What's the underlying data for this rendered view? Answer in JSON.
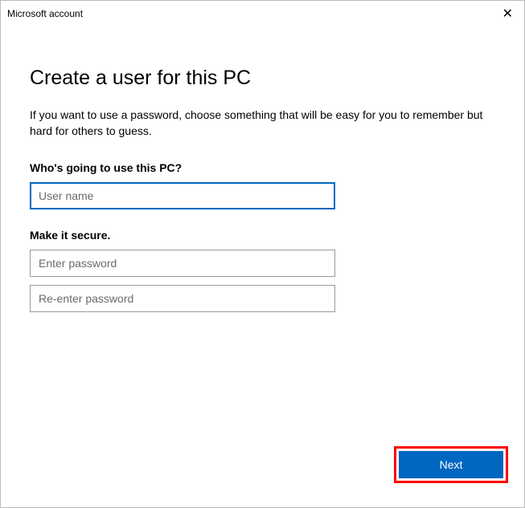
{
  "titlebar": {
    "title": "Microsoft account",
    "close_glyph": "✕"
  },
  "heading": "Create a user for this PC",
  "sub": "If you want to use a password, choose something that will be easy for you to remember but hard for others to guess.",
  "section_username": {
    "label": "Who's going to use this PC?",
    "placeholder": "User name",
    "value": ""
  },
  "section_password": {
    "label": "Make it secure.",
    "placeholder1": "Enter password",
    "placeholder2": "Re-enter password",
    "value1": "",
    "value2": ""
  },
  "footer": {
    "next_label": "Next"
  }
}
